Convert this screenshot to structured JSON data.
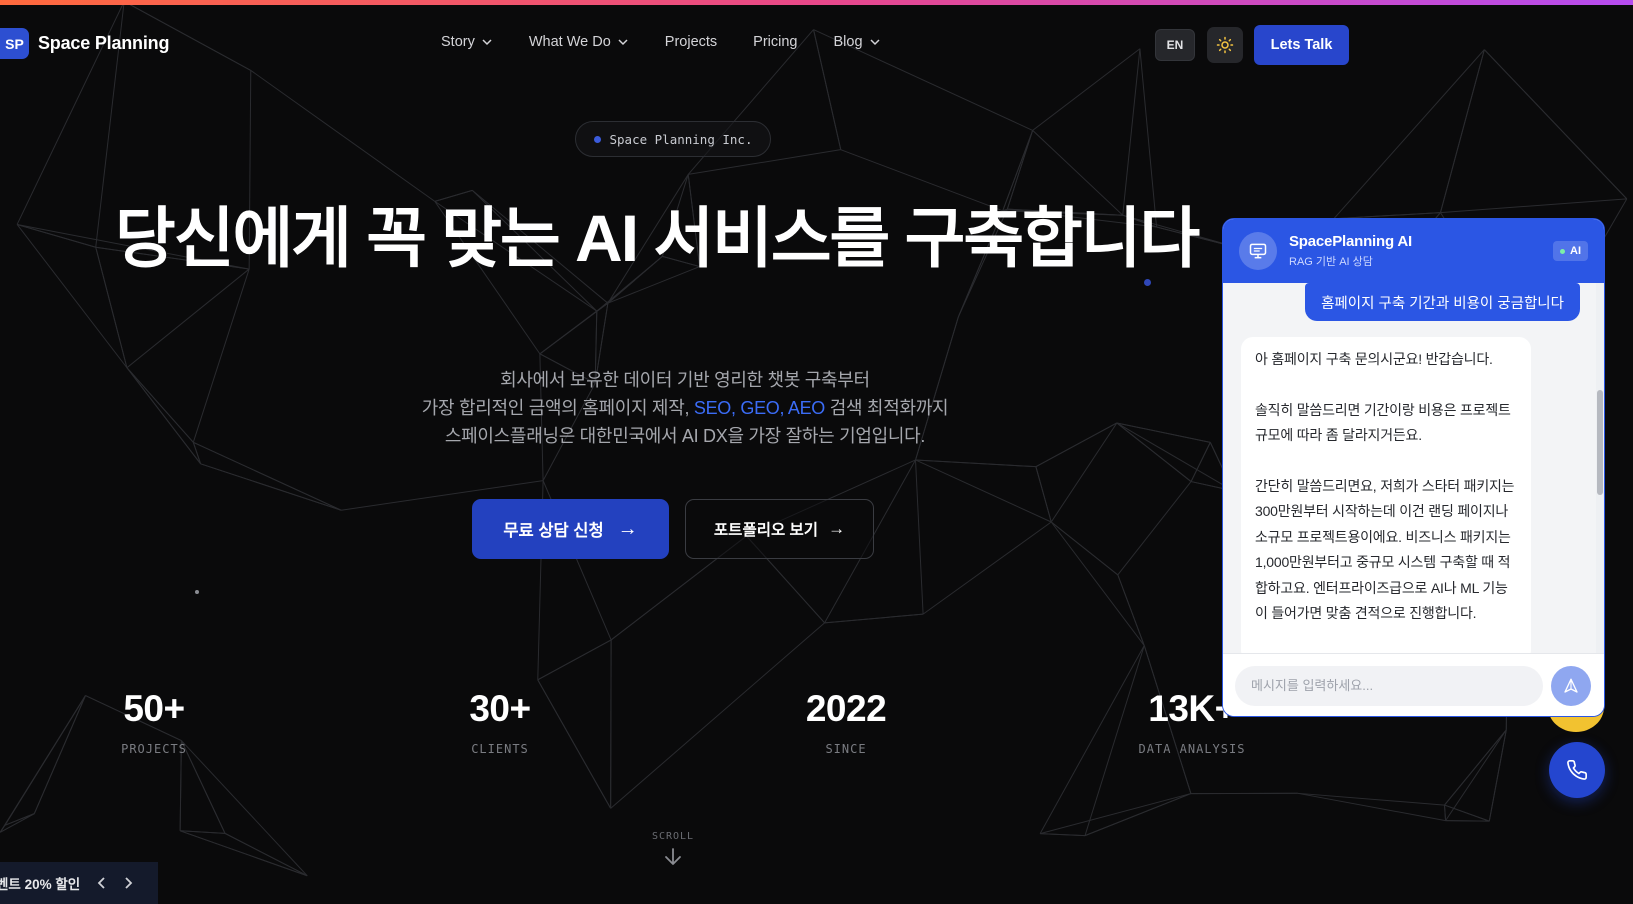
{
  "header": {
    "logo_mark": "SP",
    "logo_text": "Space Planning",
    "nav": [
      {
        "label": "Story",
        "has_dropdown": true
      },
      {
        "label": "What We Do",
        "has_dropdown": true
      },
      {
        "label": "Projects",
        "has_dropdown": false
      },
      {
        "label": "Pricing",
        "has_dropdown": false
      },
      {
        "label": "Blog",
        "has_dropdown": true
      }
    ],
    "lang_label": "EN",
    "theme_icon": "sun-icon",
    "cta_label": "Lets Talk"
  },
  "hero": {
    "badge": "Space Planning Inc.",
    "title": "당신에게 꼭 맞는 AI 서비스를 구축합니다",
    "desc_line1": "회사에서 보유한 데이터 기반 영리한 챗봇 구축부터",
    "desc_line2_pre": "가장 합리적인 금액의 홈페이지 제작, ",
    "desc_line2_hl": "SEO, GEO, AEO",
    "desc_line2_post": " 검색 최적화까지",
    "desc_line3": "스페이스플래닝은 대한민국에서 AI DX을 가장 잘하는 기업입니다.",
    "primary_cta": "무료 상담 신청",
    "primary_cta_arrow": "→",
    "secondary_cta": "포트폴리오 보기",
    "secondary_cta_arrow": "→"
  },
  "stats": [
    {
      "value": "50+",
      "label": "PROJECTS"
    },
    {
      "value": "30+",
      "label": "CLIENTS"
    },
    {
      "value": "2022",
      "label": "SINCE"
    },
    {
      "value": "13K+",
      "label": "DATA ANALYSIS"
    }
  ],
  "scroll_label": "SCROLL",
  "promo": {
    "text": "벤트 20% 할인"
  },
  "chat": {
    "title": "SpacePlanning AI",
    "subtitle": "RAG 기반 AI 상담",
    "badge": "AI",
    "user_message": "홈페이지 구축 기간과 비용이 궁금합니다",
    "bot_paragraphs": [
      "아 홈페이지 구축 문의시군요! 반갑습니다.",
      "솔직히 말씀드리면 기간이랑 비용은 프로젝트 규모에 따라 좀 달라지거든요.",
      "간단히 말씀드리면요, 저희가 스타터 패키지는 300만원부터 시작하는데 이건 랜딩 페이지나 소규모 프로젝트용이에요. 비즈니스 패키지는 1,000만원부터고 중규모 시스템 구축할 때 적합하고요. 엔터프라이즈급으로 AI나 ML 기능이 들어가면 맞춤 견적으로 진행합니다."
    ],
    "input_placeholder": "메시지를 입력하세요..."
  },
  "colors": {
    "accent": "#2b56e4",
    "cta": "#2341bf",
    "highlight": "#3b6cf6",
    "background": "#0a0a0b"
  }
}
